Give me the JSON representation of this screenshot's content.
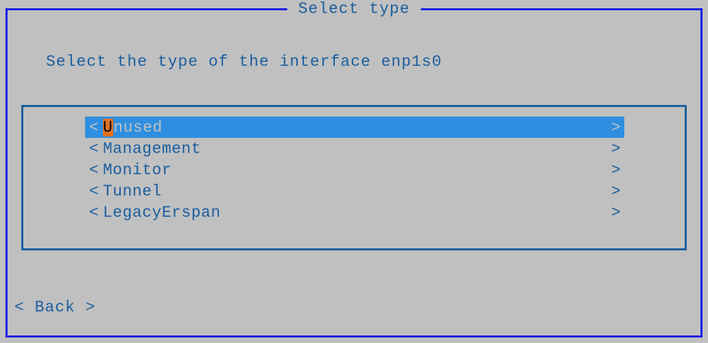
{
  "title": "Select type",
  "prompt": "Select the type of the interface enp1s0",
  "menu": {
    "items": [
      {
        "label": "Unused",
        "hotkey": "U",
        "rest": "nused",
        "selected": true
      },
      {
        "label": "Management",
        "hotkey": "",
        "rest": "Management",
        "selected": false
      },
      {
        "label": "Monitor",
        "hotkey": "",
        "rest": "Monitor",
        "selected": false
      },
      {
        "label": "Tunnel",
        "hotkey": "",
        "rest": "Tunnel",
        "selected": false
      },
      {
        "label": "LegacyErspan",
        "hotkey": "",
        "rest": "LegacyErspan",
        "selected": false
      }
    ]
  },
  "back_label": "Back",
  "glyphs": {
    "angle_left": "<",
    "angle_right": ">"
  },
  "colors": {
    "background": "#c0c0c0",
    "border": "#1a1ae6",
    "text": "#1a5fa0",
    "selected_bg": "#2e8fe0",
    "selected_fg": "#c0c0c0",
    "hotkey_bg": "#e07020"
  }
}
